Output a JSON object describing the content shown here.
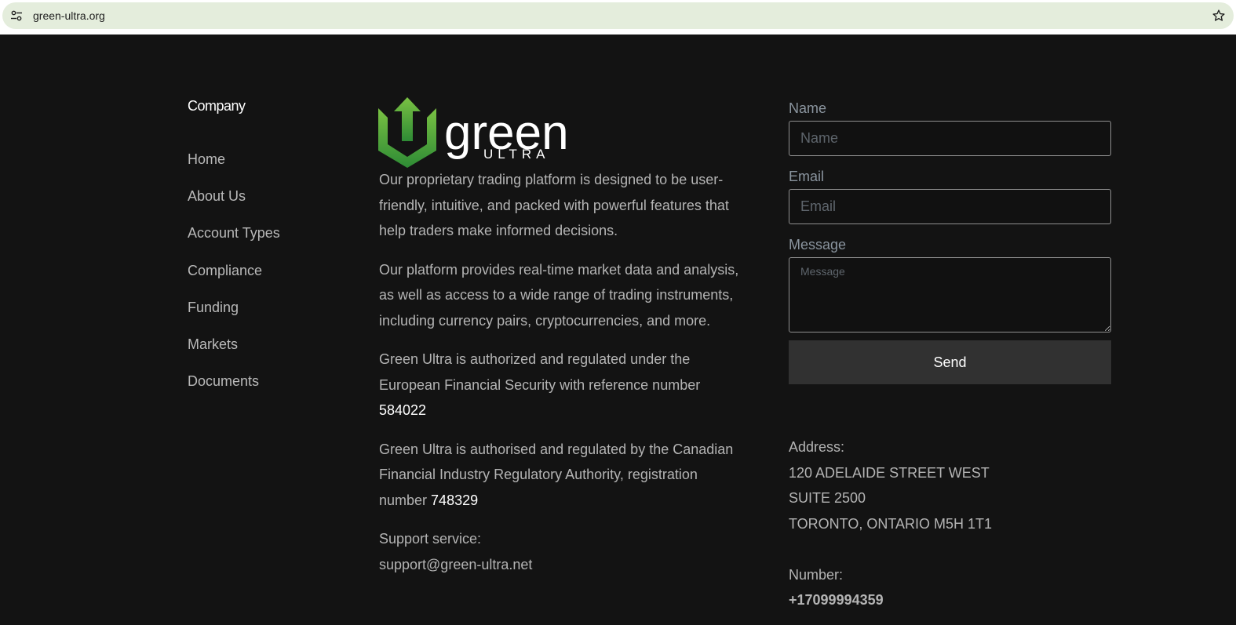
{
  "browser": {
    "url": "green-ultra.org",
    "site_info_icon": "tune-icon",
    "bookmark_icon": "star-icon"
  },
  "footer": {
    "company_heading": "Company",
    "nav": [
      {
        "label": "Home"
      },
      {
        "label": "About Us"
      },
      {
        "label": "Account Types"
      },
      {
        "label": "Compliance"
      },
      {
        "label": "Funding"
      },
      {
        "label": "Markets"
      },
      {
        "label": "Documents"
      }
    ],
    "logo": {
      "word": "green",
      "sub": "ULTRA",
      "colors": {
        "arrow_light": "#7ac143",
        "arrow_dark": "#2e8b35"
      }
    },
    "about": {
      "p1": "Our proprietary trading platform is designed to be user-friendly, intuitive, and packed with powerful features that help traders make informed decisions.",
      "p2": "Our platform provides real-time market data and analysis, as well as access to a wide range of trading instruments, including currency pairs, cryptocurrencies, and more.",
      "p3_text": "Green Ultra is authorized and regulated under the European Financial Security with reference number",
      "p3_number": "584022",
      "p4_text": "Green Ultra is authorised and regulated by the Canadian Financial Industry Regulatory Authority, registration number",
      "p4_number": "748329",
      "support_label": "Support service:",
      "support_email": "support@green-ultra.net"
    },
    "form": {
      "name_label": "Name",
      "name_placeholder": "Name",
      "name_value": "",
      "email_label": "Email",
      "email_placeholder": "Email",
      "email_value": "",
      "message_label": "Message",
      "message_placeholder": "Message",
      "message_value": "",
      "send_label": "Send"
    },
    "contact": {
      "address_label": "Address:",
      "address_line1": "120 ADELAIDE STREET WEST",
      "address_line2": "SUITE 2500",
      "address_line3": "TORONTO, ONTARIO M5H 1T1",
      "number_label": "Number:",
      "number": "+17099994359"
    }
  }
}
